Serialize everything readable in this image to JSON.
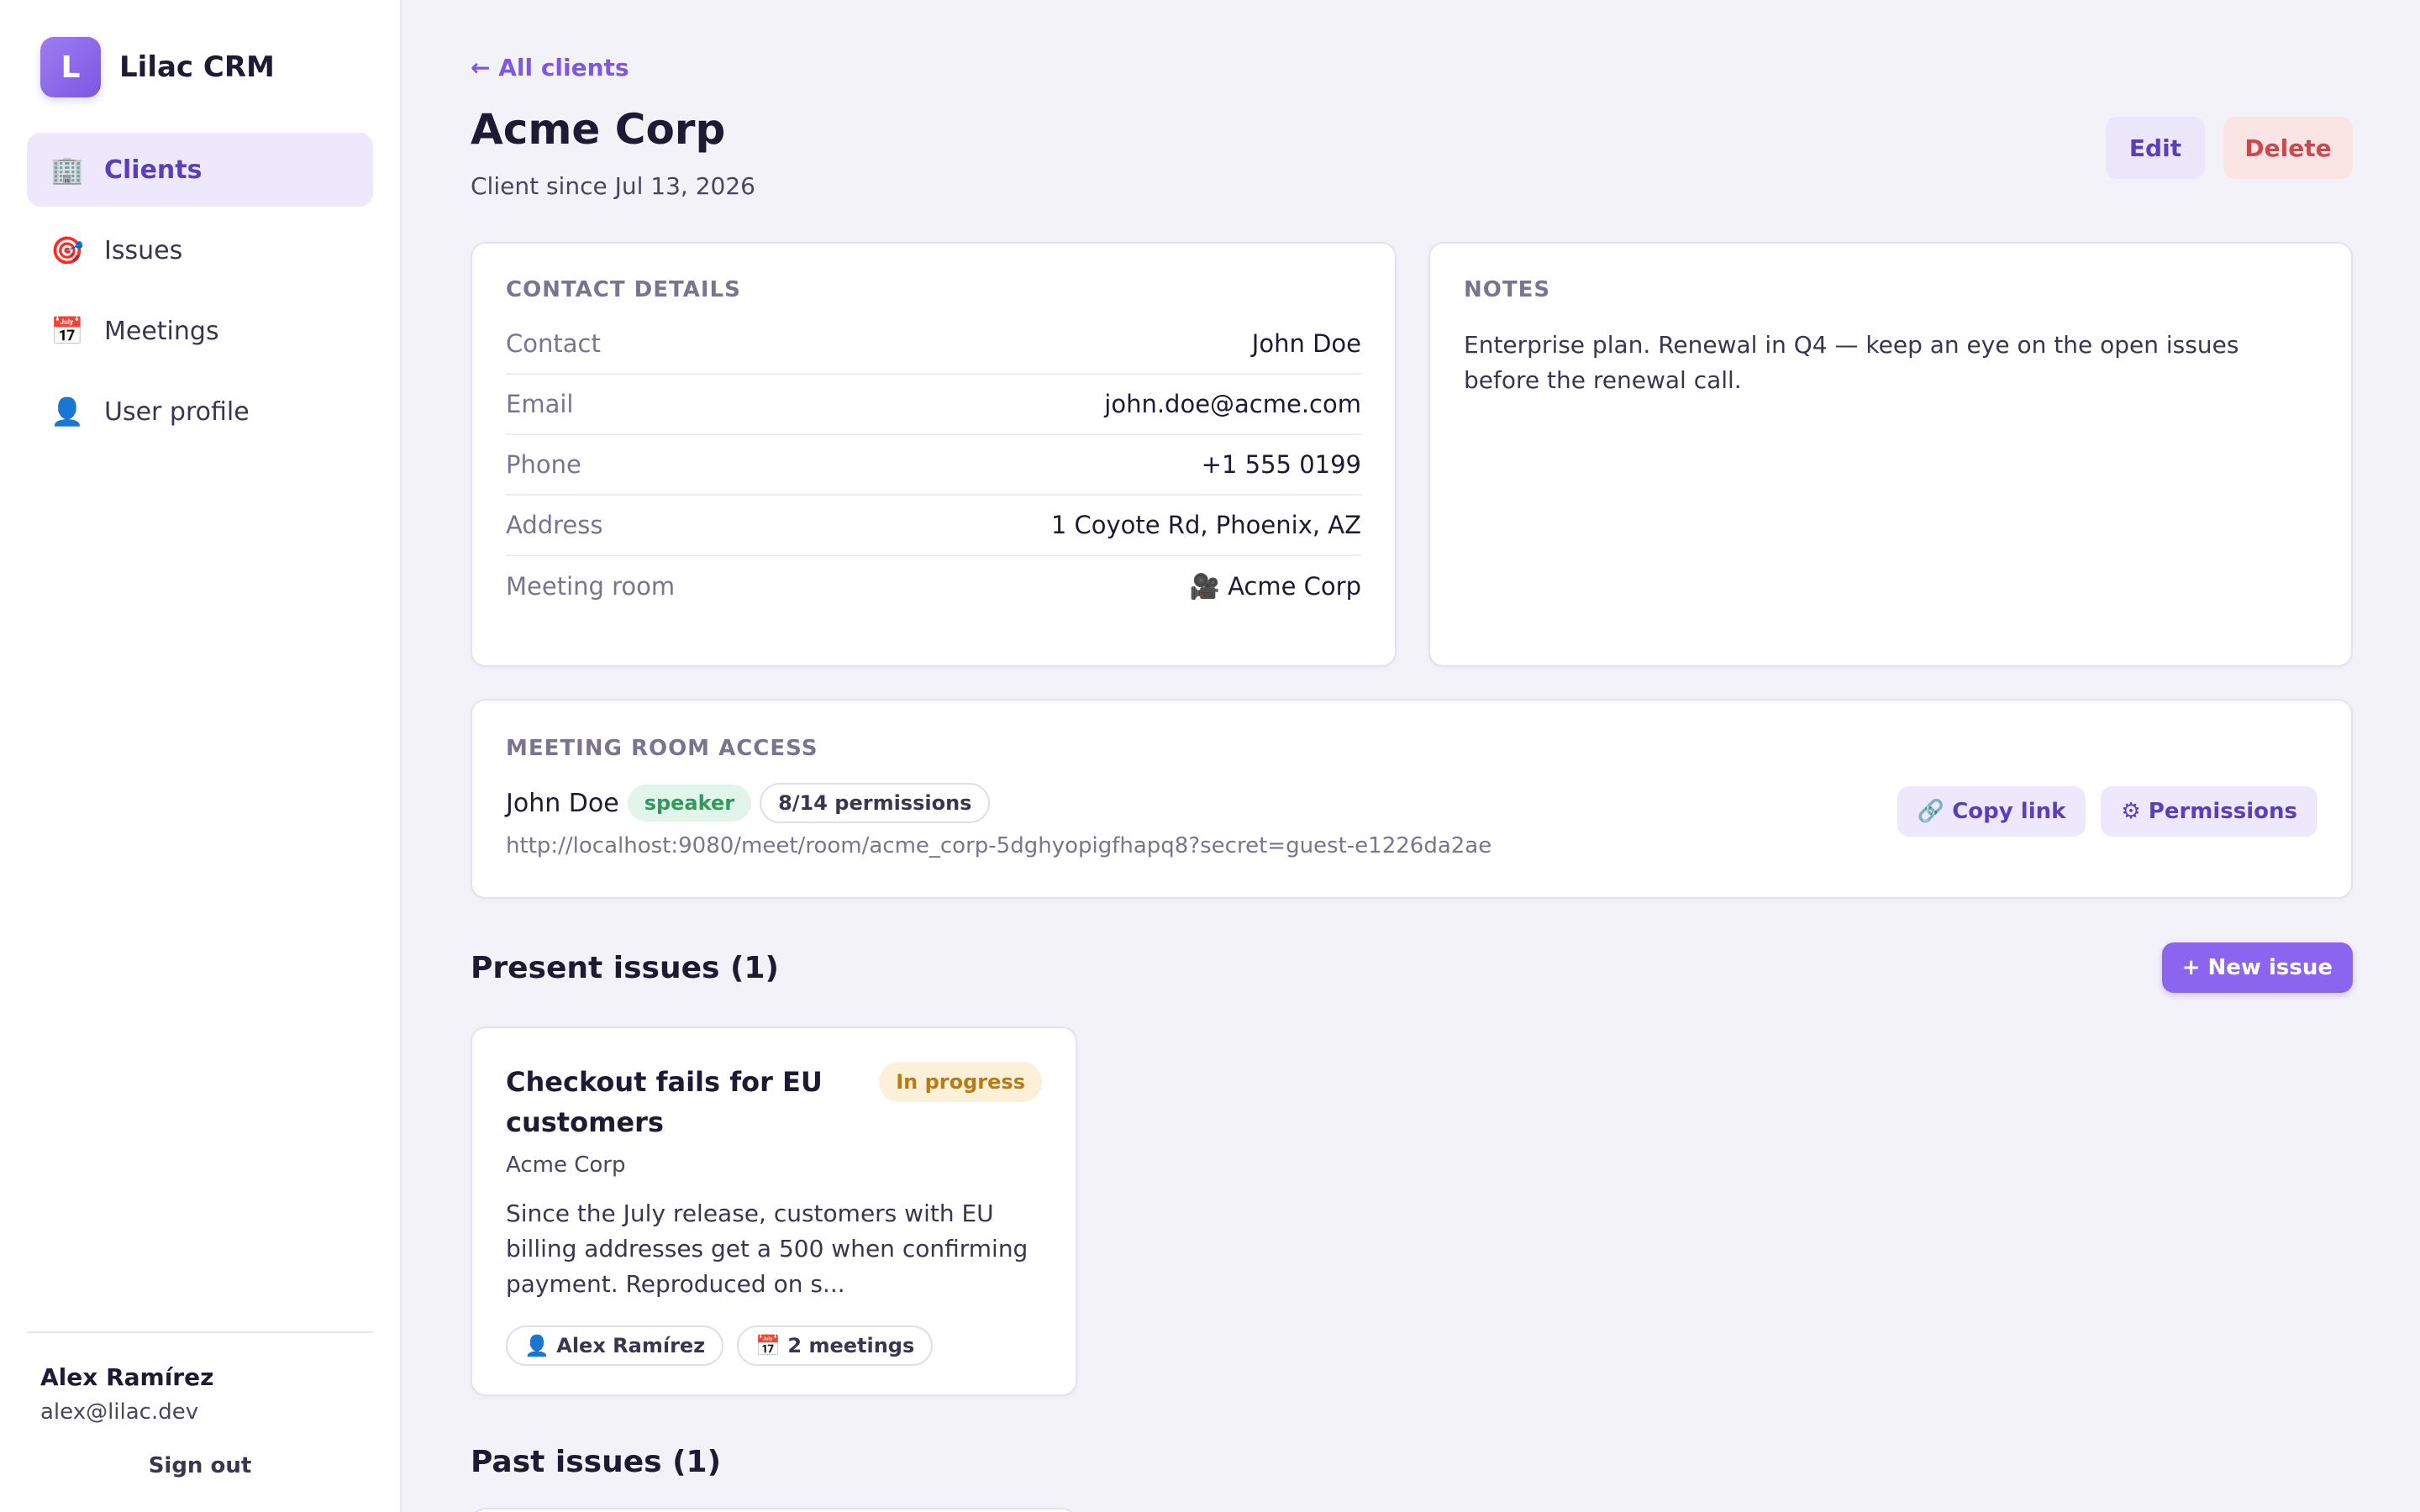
{
  "brand": {
    "logo_letter": "L",
    "name": "Lilac CRM"
  },
  "nav": [
    {
      "icon": "🏢",
      "icon_name": "building-icon",
      "label": "Clients",
      "active": true
    },
    {
      "icon": "🎯",
      "icon_name": "target-icon",
      "label": "Issues",
      "active": false
    },
    {
      "icon": "📅",
      "icon_name": "calendar-icon",
      "label": "Meetings",
      "active": false
    },
    {
      "icon": "👤",
      "icon_name": "user-icon",
      "label": "User profile",
      "active": false
    }
  ],
  "user": {
    "name": "Alex Ramírez",
    "email": "alex@lilac.dev",
    "sign_out": "Sign out"
  },
  "back_link": "← All clients",
  "client": {
    "title": "Acme Corp",
    "subtitle": "Client since Jul 13, 2026"
  },
  "actions": {
    "edit": "Edit",
    "delete": "Delete"
  },
  "contact": {
    "section_label": "CONTACT DETAILS",
    "rows": [
      {
        "label": "Contact",
        "value": "John Doe"
      },
      {
        "label": "Email",
        "value": "john.doe@acme.com"
      },
      {
        "label": "Phone",
        "value": "+1 555 0199"
      },
      {
        "label": "Address",
        "value": "1 Coyote Rd, Phoenix, AZ"
      },
      {
        "label": "Meeting room",
        "value": "🎥 Acme Corp"
      }
    ]
  },
  "notes": {
    "section_label": "NOTES",
    "text": "Enterprise plan. Renewal in Q4 — keep an eye on the open issues before the renewal call."
  },
  "access": {
    "section_label": "MEETING ROOM ACCESS",
    "name": "John Doe",
    "role": "speaker",
    "permissions": "8/14 permissions",
    "url": "http://localhost:9080/meet/room/acme_corp-5dghyopigfhapq8?secret=guest-e1226da2ae",
    "copy_link": "🔗 Copy link",
    "permissions_button": "⚙ Permissions"
  },
  "present_issues": {
    "title": "Present issues (1)",
    "new_issue": "+ New issue",
    "items": [
      {
        "title": "Checkout fails for EU customers",
        "status": "In progress",
        "client": "Acme Corp",
        "description": "Since the July release, customers with EU billing addresses get a 500 when confirming payment. Reproduced on s...",
        "assignee": "👤 Alex Ramírez",
        "meetings": "📅 2 meetings"
      }
    ]
  },
  "past_issues": {
    "title": "Past issues (1)"
  },
  "colors": {
    "accent": "#7c58e4",
    "danger": "#c9494f",
    "success": "#2f9a5c",
    "warning": "#b87c12",
    "background": "#f4f2f9"
  }
}
